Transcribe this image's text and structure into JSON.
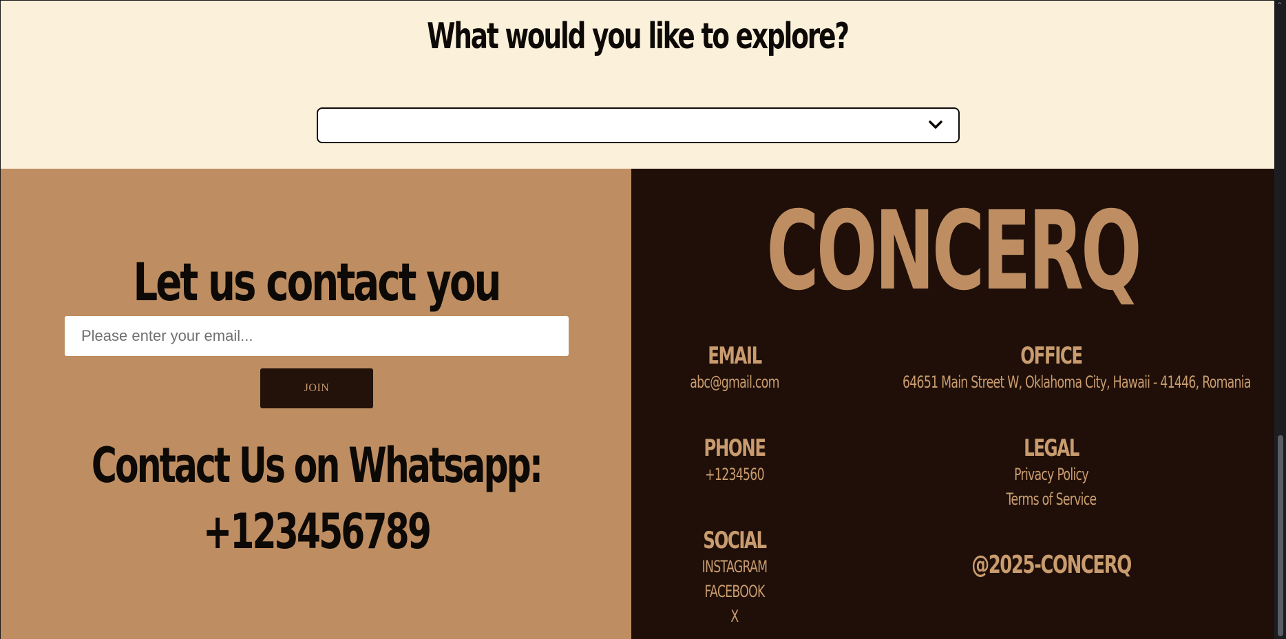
{
  "explore": {
    "title": "What would you like to explore?",
    "select_value": ""
  },
  "contact": {
    "title": "Let us contact you",
    "email_placeholder": "Please enter your email...",
    "join_label": "JOIN",
    "whatsapp_label": "Contact Us on Whatsapp:",
    "whatsapp_number": "+123456789"
  },
  "footer": {
    "brand": "CONCERQ",
    "email": {
      "heading": "EMAIL",
      "value": "abc@gmail.com"
    },
    "office": {
      "heading": "OFFICE",
      "value": "64651 Main Street W, Oklahoma City, Hawaii - 41446, Romania"
    },
    "phone": {
      "heading": "PHONE",
      "value": "+1234560"
    },
    "legal": {
      "heading": "LEGAL",
      "links": [
        "Privacy Policy",
        "Terms of Service"
      ]
    },
    "social": {
      "heading": "SOCIAL",
      "links": [
        "INSTAGRAM",
        "FACEBOOK",
        "X"
      ]
    },
    "copyright": "@2025-CONCERQ"
  },
  "colors": {
    "cream": "#fbf0da",
    "tan": "#be8e62",
    "dark_brown": "#1f0f08",
    "button_bg": "#221209"
  }
}
